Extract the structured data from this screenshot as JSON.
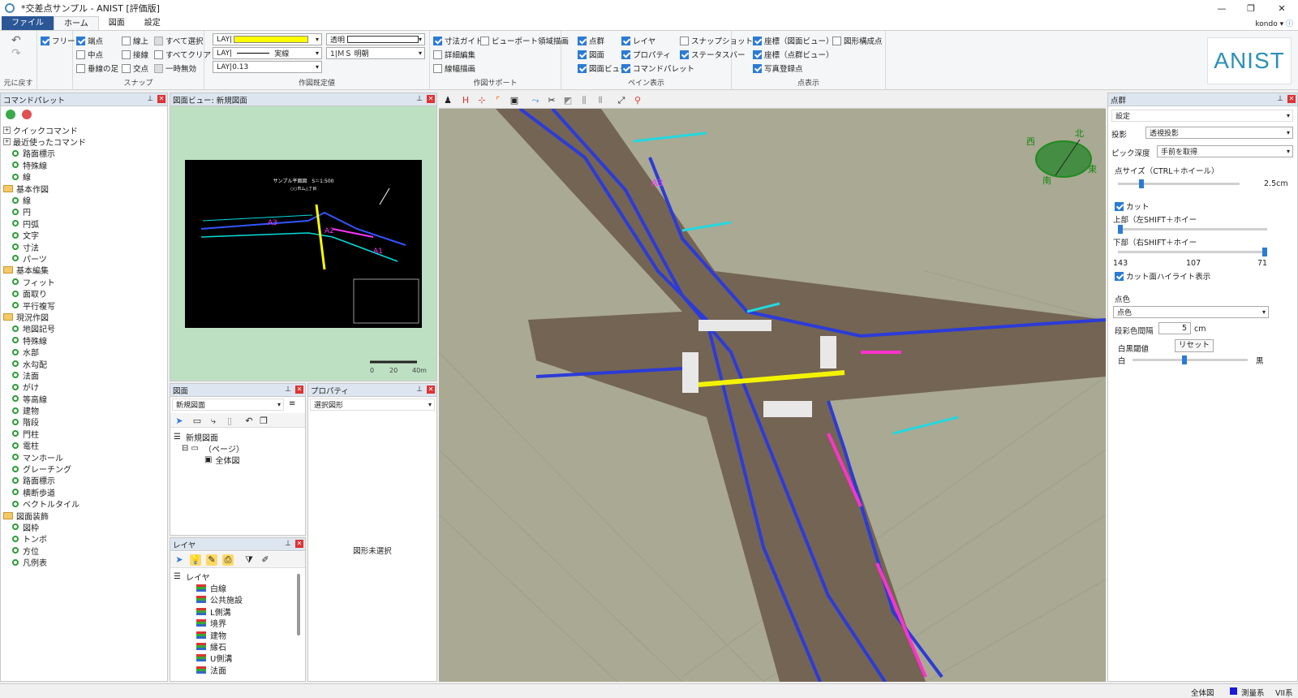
{
  "window": {
    "title": "*交差点サンプル - ANIST [評価版]",
    "minimize": "—",
    "restore": "❐",
    "close": "✕"
  },
  "menu": {
    "file": "ファイル",
    "home": "ホーム",
    "drawing": "図面",
    "settings": "設定",
    "user": "kondo",
    "info": "ⓘ"
  },
  "ribbon": {
    "undo": {
      "label": "元に戻す",
      "free": "フリー"
    },
    "snap": {
      "label": "スナップ",
      "endpoint": "端点",
      "midpoint": "中点",
      "perpendicular": "垂線の足",
      "online": "線上",
      "tangent": "接線",
      "intersection": "交点",
      "select_all": "すべて選択",
      "clear_all": "すべてクリア",
      "temp_disable": "一時無効"
    },
    "draw_defaults": {
      "label": "作図既定値",
      "layer_color": "LAY|",
      "layer_linetype": "LAY|",
      "linetype": "実線",
      "layer_width": "LAY|0.13",
      "transparency": "透明",
      "font": "1|ＭＳ 明朝"
    },
    "draw_support": {
      "label": "作図サポート",
      "dimension_guide": "寸法ガイド",
      "detail_edit": "詳細編集",
      "linewidth_draw": "線幅描画",
      "viewport_draw": "ビューポート領域描画"
    },
    "pane_display": {
      "label": "ペイン表示",
      "pointcloud": "点群",
      "drawing": "図面",
      "drawing_view": "図面ビュー",
      "layer": "レイヤ",
      "property": "プロパティ",
      "command_palette": "コマンドパレット",
      "snapshot": "スナップショット",
      "statusbar": "ステータスバー"
    },
    "point_display": {
      "label": "点表示",
      "coord_drawview": "座標（図面ビュー）",
      "coord_pointview": "座標（点群ビュー）",
      "photo_points": "写真登録点",
      "shape_points": "図形構成点"
    },
    "logo": "ANIST"
  },
  "command_palette": {
    "title": "コマンドパレット",
    "tree": [
      {
        "type": "cat",
        "label": "クイックコマンド"
      },
      {
        "type": "cat",
        "label": "最近使ったコマンド"
      },
      {
        "type": "item",
        "label": "路面標示"
      },
      {
        "type": "item",
        "label": "特殊線"
      },
      {
        "type": "item",
        "label": "線"
      },
      {
        "type": "folder",
        "label": "基本作図"
      },
      {
        "type": "item",
        "label": "線"
      },
      {
        "type": "item",
        "label": "円"
      },
      {
        "type": "item",
        "label": "円弧"
      },
      {
        "type": "item",
        "label": "文字"
      },
      {
        "type": "item",
        "label": "寸法"
      },
      {
        "type": "item",
        "label": "パーツ"
      },
      {
        "type": "folder",
        "label": "基本編集"
      },
      {
        "type": "item",
        "label": "フィット"
      },
      {
        "type": "item",
        "label": "面取り"
      },
      {
        "type": "item",
        "label": "平行複写"
      },
      {
        "type": "folder",
        "label": "現況作図"
      },
      {
        "type": "item",
        "label": "地図記号"
      },
      {
        "type": "item",
        "label": "特殊線"
      },
      {
        "type": "item",
        "label": "水部"
      },
      {
        "type": "item",
        "label": "水勾配"
      },
      {
        "type": "item",
        "label": "法面"
      },
      {
        "type": "item",
        "label": "がけ"
      },
      {
        "type": "item",
        "label": "等高線"
      },
      {
        "type": "item",
        "label": "建物"
      },
      {
        "type": "item",
        "label": "階段"
      },
      {
        "type": "item",
        "label": "門柱"
      },
      {
        "type": "item",
        "label": "電柱"
      },
      {
        "type": "item",
        "label": "マンホール"
      },
      {
        "type": "item",
        "label": "グレーチング"
      },
      {
        "type": "item",
        "label": "路面標示"
      },
      {
        "type": "item",
        "label": "横断歩道"
      },
      {
        "type": "item",
        "label": "ベクトルタイル"
      },
      {
        "type": "folder",
        "label": "図面装飾"
      },
      {
        "type": "item",
        "label": "図枠"
      },
      {
        "type": "item",
        "label": "トンボ"
      },
      {
        "type": "item",
        "label": "方位"
      },
      {
        "type": "item",
        "label": "凡例表"
      }
    ]
  },
  "drawing_view": {
    "title": "図面ビュー: 新規図面",
    "sheet_title": "サンプル平面図　S＝1:500",
    "sheet_sub": "○○市ム△丁目",
    "scale_0": "0",
    "scale_20": "20",
    "scale_40": "40m",
    "label_a1": "A1",
    "label_a2": "A2",
    "label_a3": "A3"
  },
  "drawing_pane": {
    "title": "図面",
    "select": "新規図面",
    "root": "新規図面",
    "page": "（ページ）",
    "all": "全体図"
  },
  "layer_pane": {
    "title": "レイヤ",
    "root": "レイヤ",
    "items": [
      "白線",
      "公共施設",
      "L側溝",
      "境界",
      "建物",
      "縁石",
      "U側溝",
      "法面"
    ]
  },
  "property_pane": {
    "title": "プロパティ",
    "select": "選択図形",
    "empty": "図形未選択"
  },
  "viewport": {
    "label_a3": "A3",
    "compass": {
      "n": "北",
      "s": "南",
      "e": "東",
      "w": "西"
    }
  },
  "pointcloud_pane": {
    "title": "点群",
    "setting": "設定",
    "projection_label": "投影",
    "projection": "透視投影",
    "pick_label": "ピック深度",
    "pick": "手前を取得",
    "pointsize_label": "点サイズ（CTRL＋ホイール）",
    "pointsize_value": "2.5cm",
    "pointsize_level": 0.18,
    "cut_label": "カット",
    "top_label": "上部（左SHIFT＋ホイー",
    "bottom_label": "下部（右SHIFT＋ホイー",
    "cut_low": "143",
    "cut_mid": "107",
    "cut_high": "71",
    "highlight_label": "カット面ハイライト表示",
    "color_label": "点色",
    "color_value": "点色",
    "interval_label": "段彩色間隔",
    "interval_value": "5",
    "interval_unit": "cm",
    "threshold_label": "白黒閾値",
    "reset": "リセット",
    "white": "白",
    "black": "黒",
    "threshold_level": 0.45
  },
  "status": {
    "view": "全体図",
    "system": "測量系",
    "zone": "VII系"
  }
}
